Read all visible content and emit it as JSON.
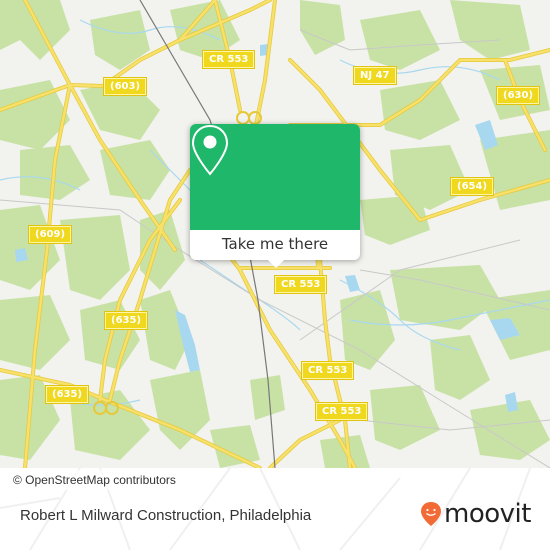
{
  "map": {
    "colors": {
      "background": "#f2f2ee",
      "forest": "#c8e2a6",
      "water": "#a8d8f0",
      "road": "#f7e16a",
      "road_outline": "#e6c93a",
      "rail": "#777777"
    },
    "road_labels": [
      {
        "id": "cr553-north",
        "text": "CR 553"
      },
      {
        "id": "603",
        "text": "(603)"
      },
      {
        "id": "nj47",
        "text": "NJ 47"
      },
      {
        "id": "630",
        "text": "(630)"
      },
      {
        "id": "654",
        "text": "(654)"
      },
      {
        "id": "609",
        "text": "(609)"
      },
      {
        "id": "cr553-center",
        "text": "CR 553"
      },
      {
        "id": "635-upper",
        "text": "(635)"
      },
      {
        "id": "635-lower",
        "text": "(635)"
      },
      {
        "id": "cr553-mid",
        "text": "CR 553"
      },
      {
        "id": "cr553-south",
        "text": "CR 553"
      }
    ],
    "attribution": "© OpenStreetMap contributors"
  },
  "popup": {
    "button_label": "Take me there",
    "icon": "location-pin-icon",
    "color": "#1fb86a"
  },
  "footer": {
    "place_name": "Robert L Milward Construction, Philadelphia",
    "logo_text": "moovit",
    "logo_color": "#f26a35"
  }
}
